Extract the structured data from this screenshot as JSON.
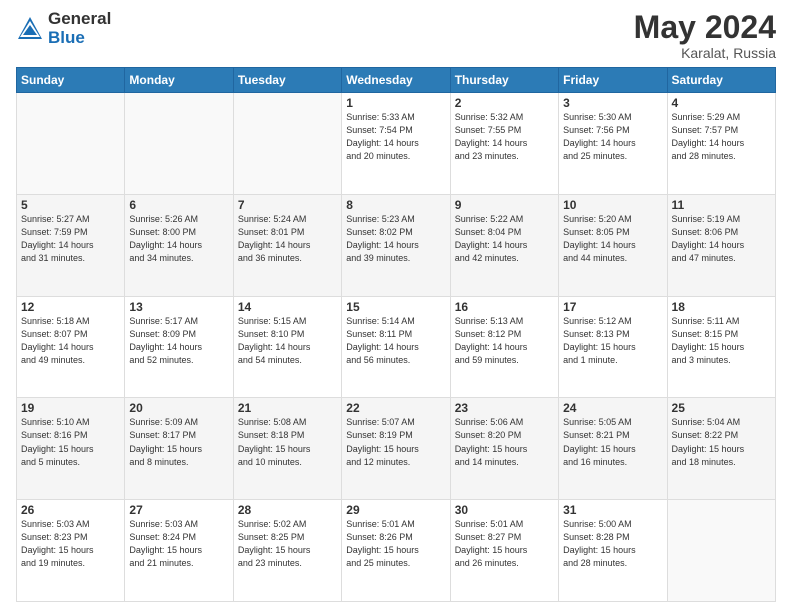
{
  "logo": {
    "general": "General",
    "blue": "Blue"
  },
  "title": {
    "month_year": "May 2024",
    "location": "Karalat, Russia"
  },
  "days_of_week": [
    "Sunday",
    "Monday",
    "Tuesday",
    "Wednesday",
    "Thursday",
    "Friday",
    "Saturday"
  ],
  "weeks": [
    [
      {
        "num": "",
        "info": ""
      },
      {
        "num": "",
        "info": ""
      },
      {
        "num": "",
        "info": ""
      },
      {
        "num": "1",
        "info": "Sunrise: 5:33 AM\nSunset: 7:54 PM\nDaylight: 14 hours\nand 20 minutes."
      },
      {
        "num": "2",
        "info": "Sunrise: 5:32 AM\nSunset: 7:55 PM\nDaylight: 14 hours\nand 23 minutes."
      },
      {
        "num": "3",
        "info": "Sunrise: 5:30 AM\nSunset: 7:56 PM\nDaylight: 14 hours\nand 25 minutes."
      },
      {
        "num": "4",
        "info": "Sunrise: 5:29 AM\nSunset: 7:57 PM\nDaylight: 14 hours\nand 28 minutes."
      }
    ],
    [
      {
        "num": "5",
        "info": "Sunrise: 5:27 AM\nSunset: 7:59 PM\nDaylight: 14 hours\nand 31 minutes."
      },
      {
        "num": "6",
        "info": "Sunrise: 5:26 AM\nSunset: 8:00 PM\nDaylight: 14 hours\nand 34 minutes."
      },
      {
        "num": "7",
        "info": "Sunrise: 5:24 AM\nSunset: 8:01 PM\nDaylight: 14 hours\nand 36 minutes."
      },
      {
        "num": "8",
        "info": "Sunrise: 5:23 AM\nSunset: 8:02 PM\nDaylight: 14 hours\nand 39 minutes."
      },
      {
        "num": "9",
        "info": "Sunrise: 5:22 AM\nSunset: 8:04 PM\nDaylight: 14 hours\nand 42 minutes."
      },
      {
        "num": "10",
        "info": "Sunrise: 5:20 AM\nSunset: 8:05 PM\nDaylight: 14 hours\nand 44 minutes."
      },
      {
        "num": "11",
        "info": "Sunrise: 5:19 AM\nSunset: 8:06 PM\nDaylight: 14 hours\nand 47 minutes."
      }
    ],
    [
      {
        "num": "12",
        "info": "Sunrise: 5:18 AM\nSunset: 8:07 PM\nDaylight: 14 hours\nand 49 minutes."
      },
      {
        "num": "13",
        "info": "Sunrise: 5:17 AM\nSunset: 8:09 PM\nDaylight: 14 hours\nand 52 minutes."
      },
      {
        "num": "14",
        "info": "Sunrise: 5:15 AM\nSunset: 8:10 PM\nDaylight: 14 hours\nand 54 minutes."
      },
      {
        "num": "15",
        "info": "Sunrise: 5:14 AM\nSunset: 8:11 PM\nDaylight: 14 hours\nand 56 minutes."
      },
      {
        "num": "16",
        "info": "Sunrise: 5:13 AM\nSunset: 8:12 PM\nDaylight: 14 hours\nand 59 minutes."
      },
      {
        "num": "17",
        "info": "Sunrise: 5:12 AM\nSunset: 8:13 PM\nDaylight: 15 hours\nand 1 minute."
      },
      {
        "num": "18",
        "info": "Sunrise: 5:11 AM\nSunset: 8:15 PM\nDaylight: 15 hours\nand 3 minutes."
      }
    ],
    [
      {
        "num": "19",
        "info": "Sunrise: 5:10 AM\nSunset: 8:16 PM\nDaylight: 15 hours\nand 5 minutes."
      },
      {
        "num": "20",
        "info": "Sunrise: 5:09 AM\nSunset: 8:17 PM\nDaylight: 15 hours\nand 8 minutes."
      },
      {
        "num": "21",
        "info": "Sunrise: 5:08 AM\nSunset: 8:18 PM\nDaylight: 15 hours\nand 10 minutes."
      },
      {
        "num": "22",
        "info": "Sunrise: 5:07 AM\nSunset: 8:19 PM\nDaylight: 15 hours\nand 12 minutes."
      },
      {
        "num": "23",
        "info": "Sunrise: 5:06 AM\nSunset: 8:20 PM\nDaylight: 15 hours\nand 14 minutes."
      },
      {
        "num": "24",
        "info": "Sunrise: 5:05 AM\nSunset: 8:21 PM\nDaylight: 15 hours\nand 16 minutes."
      },
      {
        "num": "25",
        "info": "Sunrise: 5:04 AM\nSunset: 8:22 PM\nDaylight: 15 hours\nand 18 minutes."
      }
    ],
    [
      {
        "num": "26",
        "info": "Sunrise: 5:03 AM\nSunset: 8:23 PM\nDaylight: 15 hours\nand 19 minutes."
      },
      {
        "num": "27",
        "info": "Sunrise: 5:03 AM\nSunset: 8:24 PM\nDaylight: 15 hours\nand 21 minutes."
      },
      {
        "num": "28",
        "info": "Sunrise: 5:02 AM\nSunset: 8:25 PM\nDaylight: 15 hours\nand 23 minutes."
      },
      {
        "num": "29",
        "info": "Sunrise: 5:01 AM\nSunset: 8:26 PM\nDaylight: 15 hours\nand 25 minutes."
      },
      {
        "num": "30",
        "info": "Sunrise: 5:01 AM\nSunset: 8:27 PM\nDaylight: 15 hours\nand 26 minutes."
      },
      {
        "num": "31",
        "info": "Sunrise: 5:00 AM\nSunset: 8:28 PM\nDaylight: 15 hours\nand 28 minutes."
      },
      {
        "num": "",
        "info": ""
      }
    ]
  ]
}
